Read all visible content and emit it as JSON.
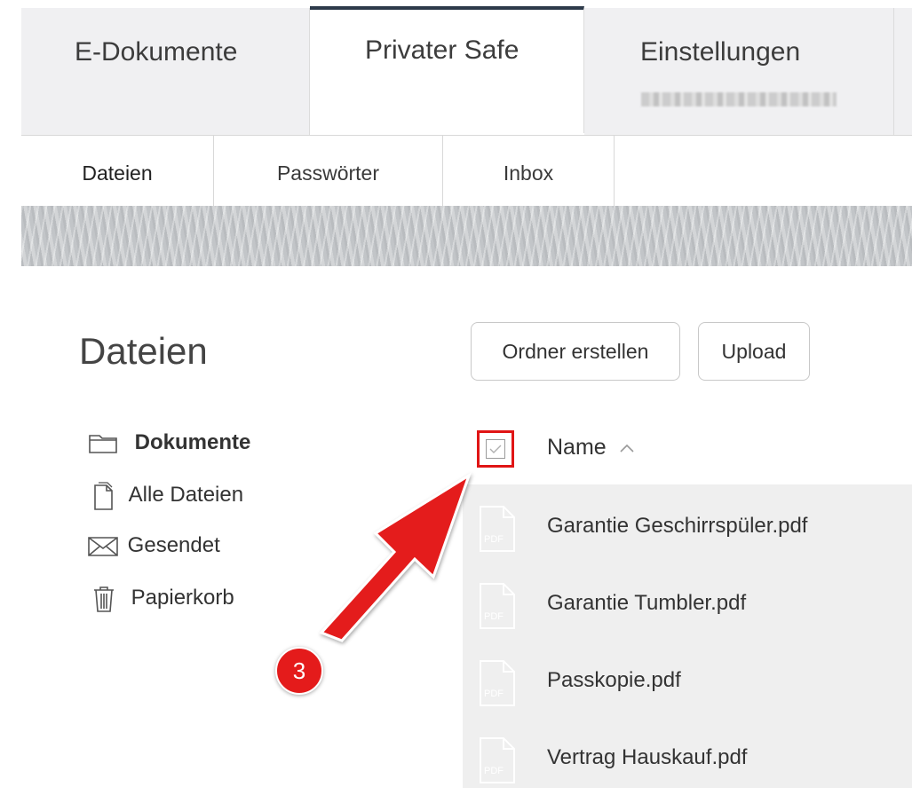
{
  "top_tabs": [
    {
      "label": "E-Dokumente"
    },
    {
      "label": "Privater Safe"
    },
    {
      "label": "Einstellungen"
    }
  ],
  "sub_tabs": [
    {
      "label": "Dateien"
    },
    {
      "label": "Passwörter"
    },
    {
      "label": "Inbox"
    }
  ],
  "page": {
    "title": "Dateien"
  },
  "toolbar": {
    "create_folder_label": "Ordner erstellen",
    "upload_label": "Upload"
  },
  "sidebar": {
    "items": [
      {
        "label": "Dokumente",
        "icon": "folder-icon"
      },
      {
        "label": "Alle Dateien",
        "icon": "file-icon"
      },
      {
        "label": "Gesendet",
        "icon": "envelope-icon"
      },
      {
        "label": "Papierkorb",
        "icon": "trash-icon"
      }
    ]
  },
  "file_list": {
    "name_header": "Name",
    "files": [
      {
        "name": "Garantie Geschirrspüler.pdf",
        "type_label": "PDF"
      },
      {
        "name": "Garantie Tumbler.pdf",
        "type_label": "PDF"
      },
      {
        "name": "Passkopie.pdf",
        "type_label": "PDF"
      },
      {
        "name": "Vertrag Hauskauf.pdf",
        "type_label": "PDF"
      }
    ]
  },
  "annotation": {
    "step_number": "3",
    "color": "#e41b1b"
  },
  "colors": {
    "active_tab_border": "#2d3a4a",
    "highlight": "#e01515",
    "list_background": "#efefef"
  }
}
